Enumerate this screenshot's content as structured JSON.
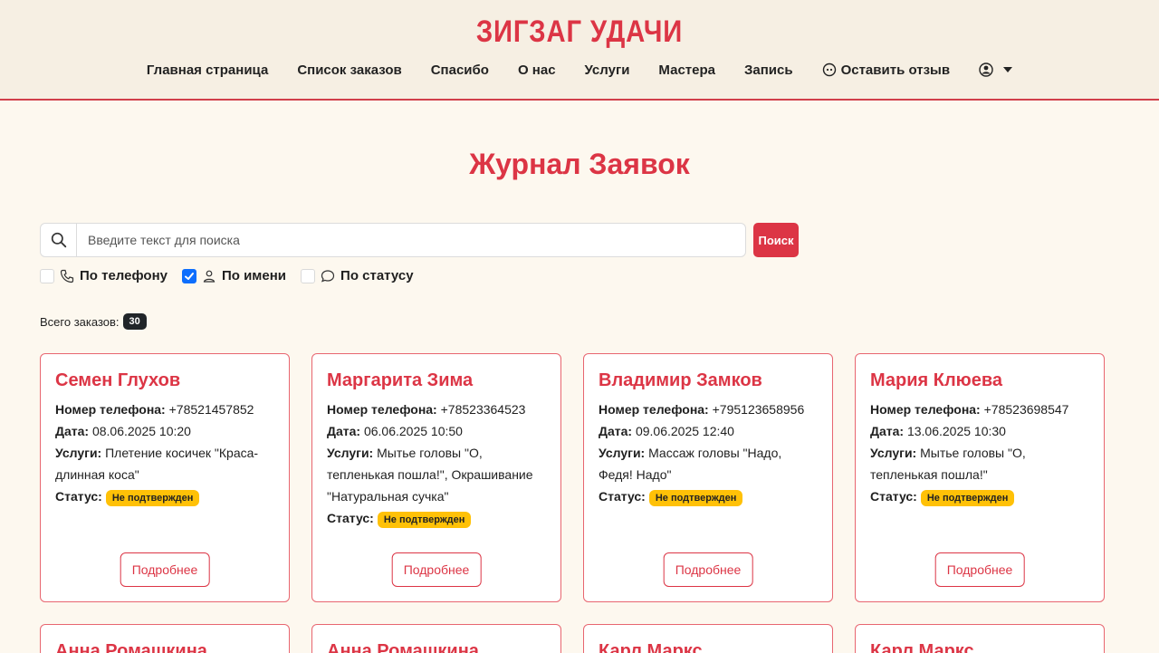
{
  "brand": "ЗИГЗАГ УДАЧИ",
  "nav": {
    "home": "Главная страница",
    "orders": "Список заказов",
    "thanks": "Спасибо",
    "about": "О нас",
    "services": "Услуги",
    "masters": "Мастера",
    "booking": "Запись",
    "review": "Оставить отзыв"
  },
  "page_title": "Журнал Заявок",
  "search": {
    "placeholder": "Введите текст для поиска",
    "button": "Поиск"
  },
  "filters": {
    "phone": {
      "label": "По телефону",
      "checked": false
    },
    "name": {
      "label": "По имени",
      "checked": true
    },
    "status": {
      "label": "По статусу",
      "checked": false
    }
  },
  "total": {
    "label": "Всего заказов:",
    "count": "30"
  },
  "labels": {
    "phone": "Номер телефона:",
    "date": "Дата:",
    "services": "Услуги:",
    "status": "Статус:",
    "more": "Подробнее"
  },
  "orders": [
    {
      "name": "Семен Глухов",
      "phone": "+78521457852",
      "date": "08.06.2025 10:20",
      "services": "Плетение косичек \"Краса-длинная коса\"",
      "status": "Не подтвержден"
    },
    {
      "name": "Маргарита Зима",
      "phone": "+78523364523",
      "date": "06.06.2025 10:50",
      "services": "Мытье головы \"О, тепленькая пошла!\", Окрашивание \"Натуральная сучка\"",
      "status": "Не подтвержден"
    },
    {
      "name": "Владимир Замков",
      "phone": "+795123658956",
      "date": "09.06.2025 12:40",
      "services": "Массаж головы \"Надо, Федя! Надо\"",
      "status": "Не подтвержден"
    },
    {
      "name": "Мария Клюева",
      "phone": "+78523698547",
      "date": "13.06.2025 10:30",
      "services": "Мытье головы \"О, тепленькая пошла!\"",
      "status": "Не подтвержден"
    },
    {
      "name": "Анна Ромашкина"
    },
    {
      "name": "Анна Ромашкина"
    },
    {
      "name": "Карл Маркс"
    },
    {
      "name": "Карл Маркс"
    }
  ],
  "colors": {
    "accent": "#dc3545",
    "warning": "#ffc107",
    "check": "#0d6efd"
  }
}
